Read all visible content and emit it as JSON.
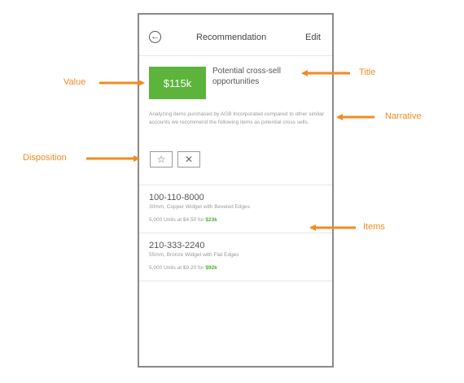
{
  "header": {
    "title": "Recommendation",
    "edit_label": "Edit",
    "back_icon": "back-arrow-icon"
  },
  "summary": {
    "value": "$115k",
    "title": "Potential cross-sell opportunities",
    "narrative": "Analyzing items purchased by AGB Incorporated compared to other similar accounts we recommend the following items as potential cross sells."
  },
  "disposition": {
    "star_icon": "star-icon",
    "dismiss_icon": "close-icon"
  },
  "items": [
    {
      "number": "100-110-8000",
      "description": "30mm, Copper Widget with Beveled Edges",
      "quantity_text": "5,000 Units at $4.50 for",
      "total": "$23k"
    },
    {
      "number": "210-333-2240",
      "description": "55mm, Bronze Widget with Flat Edges",
      "quantity_text": "5,000 Units at $9.20 for",
      "total": "$92k"
    }
  ],
  "callouts": {
    "value": "Value",
    "title": "Title",
    "narrative": "Narrative",
    "disposition": "Disposition",
    "items": "Items"
  },
  "colors": {
    "accent_orange": "#f58a1f",
    "value_green": "#5cb43c",
    "total_green": "#4caf2c"
  }
}
